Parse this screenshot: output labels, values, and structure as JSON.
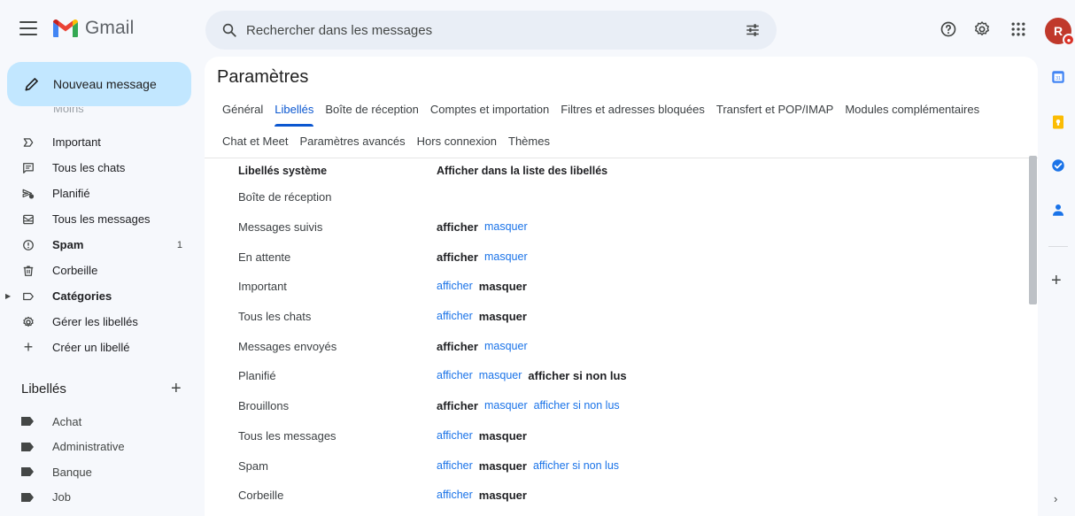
{
  "app": {
    "name": "Gmail"
  },
  "search": {
    "placeholder": "Rechercher dans les messages"
  },
  "compose": {
    "label": "Nouveau message"
  },
  "sidebar": {
    "cut_item": "Moins",
    "items": [
      {
        "label": "Important",
        "icon": "important-icon"
      },
      {
        "label": "Tous les chats",
        "icon": "chat-icon"
      },
      {
        "label": "Planifié",
        "icon": "scheduled-icon"
      },
      {
        "label": "Tous les messages",
        "icon": "all-mail-icon"
      },
      {
        "label": "Spam",
        "icon": "spam-icon",
        "count": "1"
      },
      {
        "label": "Corbeille",
        "icon": "trash-icon"
      },
      {
        "label": "Catégories",
        "icon": "label-outline-icon"
      },
      {
        "label": "Gérer les libellés",
        "icon": "gear-icon"
      },
      {
        "label": "Créer un libellé",
        "icon": "plus-icon"
      }
    ],
    "labels_title": "Libellés",
    "labels": [
      {
        "label": "Achat"
      },
      {
        "label": "Administrative"
      },
      {
        "label": "Banque"
      },
      {
        "label": "Job"
      }
    ]
  },
  "settings": {
    "title": "Paramètres",
    "tabs_row1": [
      {
        "label": "Général"
      },
      {
        "label": "Libellés"
      },
      {
        "label": "Boîte de réception"
      },
      {
        "label": "Comptes et importation"
      },
      {
        "label": "Filtres et adresses bloquées"
      },
      {
        "label": "Transfert et POP/IMAP"
      },
      {
        "label": "Modules complémentaires"
      }
    ],
    "tabs_row2": [
      {
        "label": "Chat et Meet"
      },
      {
        "label": "Paramètres avancés"
      },
      {
        "label": "Hors connexion"
      },
      {
        "label": "Thèmes"
      }
    ],
    "active_tab": "Libellés",
    "table": {
      "col1": "Libellés système",
      "col2": "Afficher dans la liste des libellés",
      "rows": [
        {
          "name": "Boîte de réception",
          "actions": []
        },
        {
          "name": "Messages suivis",
          "actions": [
            {
              "text": "afficher",
              "selected": true
            },
            {
              "text": "masquer",
              "selected": false
            }
          ]
        },
        {
          "name": "En attente",
          "actions": [
            {
              "text": "afficher",
              "selected": true
            },
            {
              "text": "masquer",
              "selected": false
            }
          ]
        },
        {
          "name": "Important",
          "actions": [
            {
              "text": "afficher",
              "selected": false
            },
            {
              "text": "masquer",
              "selected": true
            }
          ]
        },
        {
          "name": "Tous les chats",
          "actions": [
            {
              "text": "afficher",
              "selected": false
            },
            {
              "text": "masquer",
              "selected": true
            }
          ]
        },
        {
          "name": "Messages envoyés",
          "actions": [
            {
              "text": "afficher",
              "selected": true
            },
            {
              "text": "masquer",
              "selected": false
            }
          ]
        },
        {
          "name": "Planifié",
          "actions": [
            {
              "text": "afficher",
              "selected": false
            },
            {
              "text": "masquer",
              "selected": false
            },
            {
              "text": "afficher si non lus",
              "selected": true
            }
          ]
        },
        {
          "name": "Brouillons",
          "actions": [
            {
              "text": "afficher",
              "selected": true
            },
            {
              "text": "masquer",
              "selected": false
            },
            {
              "text": "afficher si non lus",
              "selected": false
            }
          ]
        },
        {
          "name": "Tous les messages",
          "actions": [
            {
              "text": "afficher",
              "selected": false
            },
            {
              "text": "masquer",
              "selected": true
            }
          ]
        },
        {
          "name": "Spam",
          "actions": [
            {
              "text": "afficher",
              "selected": false
            },
            {
              "text": "masquer",
              "selected": true
            },
            {
              "text": "afficher si non lus",
              "selected": false
            }
          ]
        },
        {
          "name": "Corbeille",
          "actions": [
            {
              "text": "afficher",
              "selected": false
            },
            {
              "text": "masquer",
              "selected": true
            }
          ]
        }
      ]
    }
  },
  "account": {
    "avatar_initial": "R"
  },
  "colors": {
    "accent": "#0b57d0",
    "link": "#1a73e8",
    "compose_bg": "#c2e7ff",
    "avatar": "#c0392b"
  }
}
